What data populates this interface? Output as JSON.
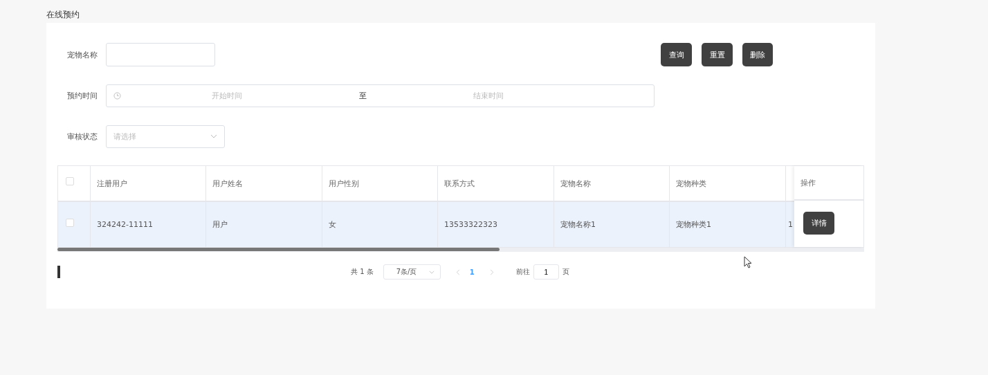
{
  "page_title": "在线预约",
  "filters": {
    "pet_name": {
      "label": "宠物名称"
    },
    "time_range": {
      "label": "预约时间",
      "start_placeholder": "开始时间",
      "separator": "至",
      "end_placeholder": "结束时间"
    },
    "status": {
      "label": "审核状态",
      "placeholder": "请选择"
    }
  },
  "buttons": [
    {
      "label": "查询"
    },
    {
      "label": "重置"
    },
    {
      "label": "删除"
    }
  ],
  "table": {
    "select_all_checked": false,
    "columns": [
      "注册用户",
      "用户姓名",
      "用户性别",
      "联系方式",
      "宠物名称",
      "宠物种类",
      ""
    ],
    "action_column": "操作",
    "rows": [
      {
        "checked": false,
        "selected": true,
        "cells": [
          "324242-11111",
          "用户",
          "女",
          "13533322323",
          "宠物名称1",
          "宠物种类1",
          "1"
        ],
        "action": "详情"
      }
    ]
  },
  "pagination": {
    "total": "共 1 条",
    "page_size": "7条/页",
    "pages": [
      {
        "label": "1",
        "selected": true
      }
    ],
    "goto_label": "前往",
    "goto_value": "1",
    "goto_suffix": "页"
  }
}
